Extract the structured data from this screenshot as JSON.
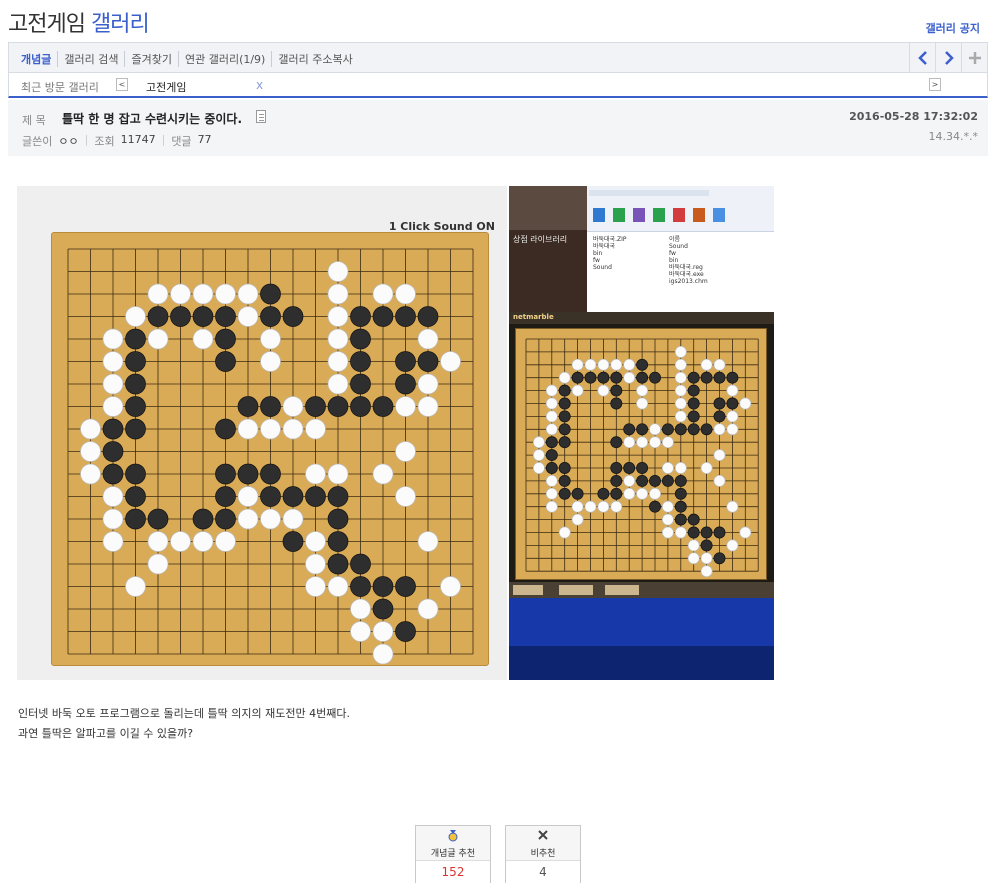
{
  "header": {
    "title_main": "고전게임",
    "title_accent": "갤러리",
    "notice_link": "갤러리 공지"
  },
  "nav": {
    "items": [
      "개념글",
      "갤러리 검색",
      "즐겨찾기",
      "연관 갤러리(1/9)",
      "갤러리 주소복사"
    ],
    "prev_icon": "chevron-left-icon",
    "next_icon": "chevron-right-icon",
    "add_icon": "plus-icon"
  },
  "recent": {
    "label": "최근 방문 갤러리",
    "item": "고전게임",
    "close": "x"
  },
  "post": {
    "subject_label": "제 목",
    "subject": "틀딱 한 명 잡고 수련시키는 중이다.",
    "date": "2016-05-28 17:32:02",
    "author_label": "글쓴이",
    "author": "ㅇㅇ",
    "views_label": "조회",
    "views": "11747",
    "comments_label": "댓글",
    "comments": "77",
    "ip": "14.34.*.*"
  },
  "screenshot": {
    "left_caption": "1 Click    Sound ON",
    "library_tabs": "상점   라이브러리",
    "brand": "netmarble",
    "tree_items": [
      "바둑대국.ZIP",
      "바둑대국",
      "bin",
      "fw",
      "Sound"
    ],
    "file_items": [
      "이름",
      "Sound",
      "fw",
      "bin",
      "바둑대국.reg",
      "바둑대국.exe",
      "igs2013.chm"
    ]
  },
  "body": {
    "lines": [
      "인터넷 바둑 오토 프로그램으로 돌리는데 틀딱 의지의 재도전만 4번째다.",
      "과연 틀딱은 알파고를 이길 수 있을까?"
    ]
  },
  "votes": {
    "up_label": "개념글 추천",
    "up_count": "152",
    "up_icon": "medal-icon",
    "down_label": "비추천",
    "down_count": "4",
    "down_icon": "x-icon"
  },
  "colors": {
    "accent": "#3b5fcb",
    "board": "#d9ab57",
    "recommend": "#dd3333"
  }
}
